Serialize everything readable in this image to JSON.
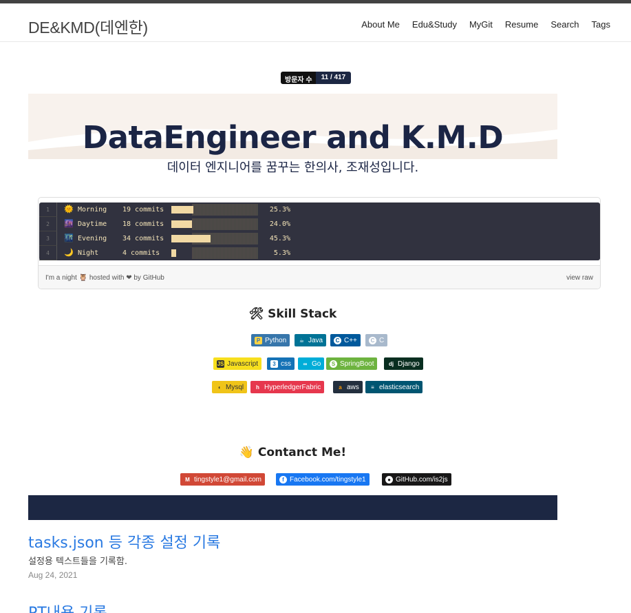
{
  "site": {
    "title": "DE&KMD(데엔한)"
  },
  "nav": [
    "About Me",
    "Edu&Study",
    "MyGit",
    "Resume",
    "Search",
    "Tags"
  ],
  "visitor_badge": {
    "label": "방문자 수",
    "value": "11 / 417"
  },
  "banner": {
    "title": "DataEngineer and K.M.D",
    "subtitle": "데이터 엔지니어를 꿈꾸는 한의사, 조재성입니다."
  },
  "gist": {
    "rows": [
      {
        "line": "1",
        "icon": "🌞",
        "name": "Morning",
        "commits": "19 commits",
        "percent": "25.3%",
        "fraction": 0.253
      },
      {
        "line": "2",
        "icon": "🌆",
        "name": "Daytime",
        "commits": "18 commits",
        "percent": "24.0%",
        "fraction": 0.24
      },
      {
        "line": "3",
        "icon": "🌃",
        "name": "Evening",
        "commits": "34 commits",
        "percent": "45.3%",
        "fraction": 0.453
      },
      {
        "line": "4",
        "icon": "🌙",
        "name": "Night",
        "commits": "4 commits",
        "percent": "5.3%",
        "fraction": 0.053
      }
    ],
    "footer_left": "I'm a night 🦉 hosted with ❤ by GitHub",
    "footer_right": "view raw"
  },
  "skill_stack": {
    "heading": "🛠 Skill Stack",
    "rows": [
      [
        {
          "label": "Python",
          "color": "#3776ab",
          "icon": "python-icon"
        },
        {
          "label": "Java",
          "color": "#007396",
          "icon": "java-icon"
        },
        {
          "label": "C++",
          "color": "#00599c",
          "icon": "cpp-icon"
        },
        {
          "label": "C",
          "color": "#a8b9cc",
          "icon": "c-icon"
        }
      ],
      [
        {
          "label": "Javascript",
          "color": "#f7df1e",
          "icon": "javascript-icon"
        },
        {
          "label": "css",
          "color": "#1572b6",
          "icon": "css-icon"
        },
        {
          "label": "Go",
          "color": "#00add8",
          "icon": "go-icon"
        },
        {
          "label": "SpringBoot",
          "color": "#6db33f",
          "icon": "springboot-icon"
        },
        {
          "label": "Django",
          "color": "#092e20",
          "icon": "django-icon"
        }
      ],
      [
        {
          "label": "Mysql",
          "color": "#f0c419",
          "icon": "mysql-icon"
        },
        {
          "label": "HyperledgerFabric",
          "color": "#e6374d",
          "icon": "hyperledger-icon"
        },
        {
          "label": "aws",
          "color": "#232f3e",
          "icon": "aws-icon"
        },
        {
          "label": "elasticsearch",
          "color": "#005571",
          "icon": "elasticsearch-icon"
        }
      ]
    ]
  },
  "contact": {
    "heading": "👋 Contanct Me!",
    "links": [
      {
        "label": "tingstyle1@gmail.com",
        "color": "#d14836",
        "icon": "gmail-icon"
      },
      {
        "label": "Facebook.com/tingstyle1",
        "color": "#1877f2",
        "icon": "facebook-icon"
      },
      {
        "label": "GitHub.com/is2js",
        "color": "#181717",
        "icon": "github-icon"
      }
    ]
  },
  "posts": [
    {
      "title": "tasks.json 등 각종 설정 기록",
      "excerpt": "설정용 텍스트들을 기록함.",
      "date": "Aug 24, 2021"
    },
    {
      "title": "PT내용 기록",
      "excerpt": "",
      "date": ""
    }
  ]
}
